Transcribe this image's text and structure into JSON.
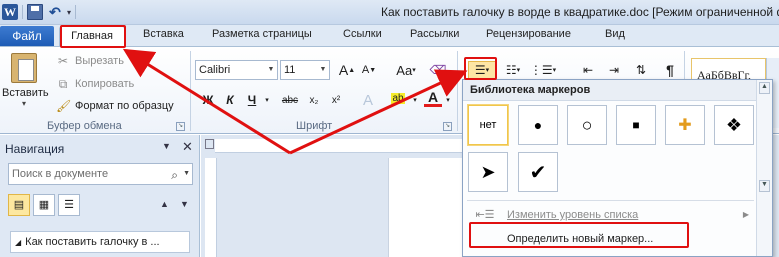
{
  "window": {
    "title": "Как поставить галочку в ворде в квадратике.doc [Режим ограниченной ф"
  },
  "qat": {
    "word_icon": "W",
    "icons": [
      "word-icon",
      "save-icon",
      "undo-icon"
    ]
  },
  "ribbon_tabs": {
    "file": "Файл",
    "items": [
      "Главная",
      "Вставка",
      "Разметка страницы",
      "Ссылки",
      "Рассылки",
      "Рецензирование",
      "Вид"
    ],
    "active": "Главная"
  },
  "clipboard": {
    "paste_label": "Вставить",
    "cut": "Вырезать",
    "copy": "Копировать",
    "format_painter": "Формат по образцу",
    "group_label": "Буфер обмена"
  },
  "font": {
    "name": "Calibri",
    "size": "11",
    "group_label": "Шрифт",
    "grow": "A",
    "shrink": "A",
    "case": "Aa",
    "bold": "Ж",
    "italic": "К",
    "underline": "Ч",
    "strike": "abc",
    "sub": "x₂",
    "sup": "x²",
    "effects": "A",
    "highlight": "ab",
    "color": "A"
  },
  "paragraph": {
    "pilcrow": "¶"
  },
  "styles": {
    "preview": "АаБбВвГг,"
  },
  "navigation": {
    "title": "Навигация",
    "search_placeholder": "Поиск в документе",
    "doc_heading": "Как поставить галочку в ..."
  },
  "bullet_library": {
    "header": "Библиотека маркеров",
    "none_label": "нет",
    "symbols": [
      "●",
      "○",
      "■",
      "✚",
      "❖",
      "➤",
      "✔"
    ],
    "change_level": "Изменить уровень списка",
    "define_new": "Определить новый маркер..."
  },
  "annotation_colors": {
    "highlight": "#e01010"
  }
}
